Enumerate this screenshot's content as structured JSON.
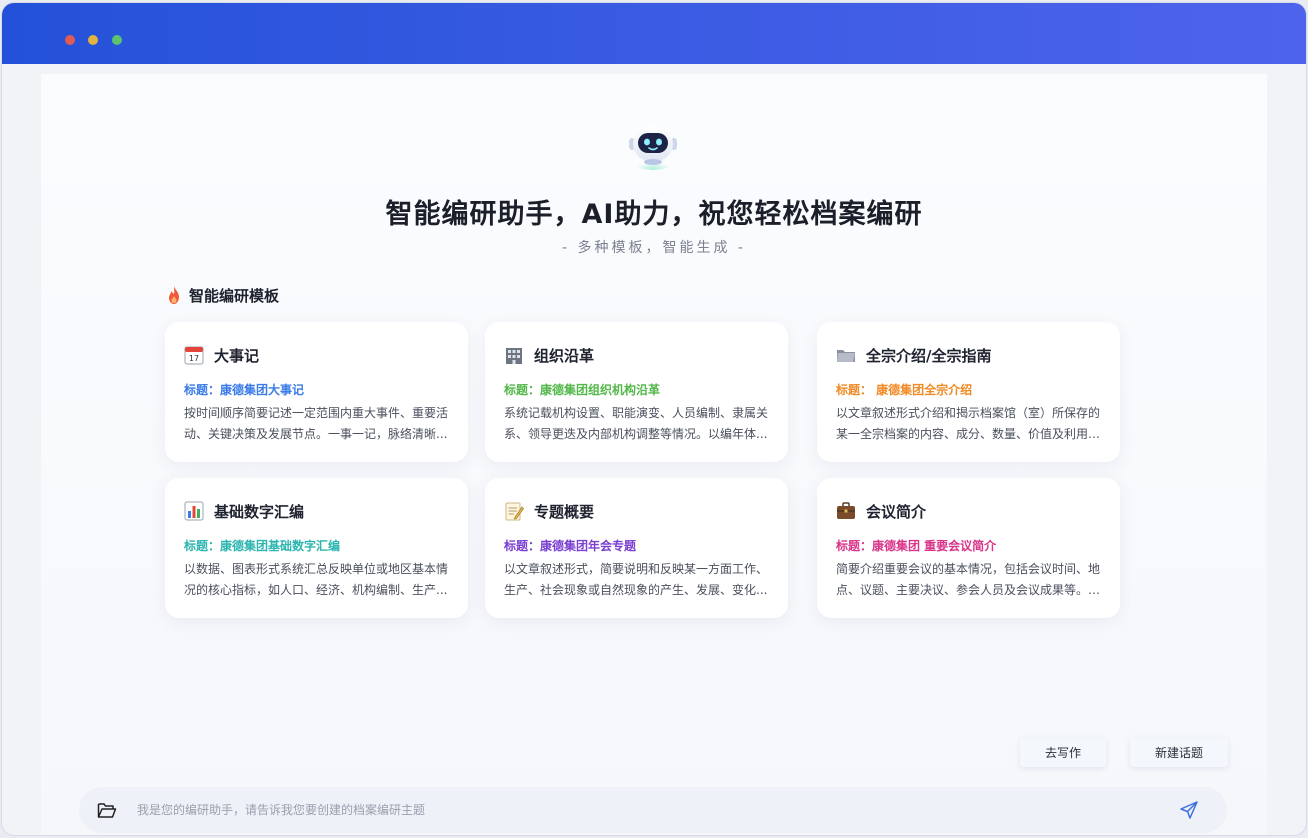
{
  "window": {
    "colors": {
      "titlebar_start": "#2451d9",
      "titlebar_end": "#4e63ec"
    }
  },
  "hero": {
    "title": "智能编研助手，AI助力，祝您轻松档案编研",
    "subtitle": "- 多种模板，智能生成 -",
    "mascot_icon": "robot-icon"
  },
  "section": {
    "title": "智能编研模板",
    "icon": "flame-icon"
  },
  "templates": [
    {
      "icon": "calendar-icon",
      "title": "大事记",
      "subtitle": "标题：康德集团大事记",
      "subtitle_color": "#3b7be8",
      "description": "按时间顺序简要记述一定范围内重大事件、重要活动、关键决策及发展节点。一事一记，脉络清晰..."
    },
    {
      "icon": "building-icon",
      "title": "组织沿革",
      "subtitle": "标题：康德集团组织机构沿革",
      "subtitle_color": "#52b84a",
      "description": "系统记载机构设置、职能演变、人员编制、隶属关系、领导更迭及内部机构调整等情况。以编年体..."
    },
    {
      "icon": "folder-icon",
      "title": "全宗介绍/全宗指南",
      "subtitle": "标题： 康德集团全宗介绍",
      "subtitle_color": "#f08a24",
      "description": "以文章叙述形式介绍和揭示档案馆（室）所保存的某一全宗档案的内容、成分、数量、价值及利用注意事项..."
    },
    {
      "icon": "bar-chart-icon",
      "title": "基础数字汇编",
      "subtitle": "标题：康德集团基础数字汇编",
      "subtitle_color": "#2cb5b0",
      "description": "以数据、图表形式系统汇总反映单位或地区基本情况的核心指标，如人口、经济、机构编制、生产..."
    },
    {
      "icon": "memo-icon",
      "title": "专题概要",
      "subtitle": "标题：康德集团年会专题",
      "subtitle_color": "#7a3fd1",
      "description": "以文章叙述形式，简要说明和反映某一方面工作、生产、社会现象或自然现象的产生、发展、变化..."
    },
    {
      "icon": "briefcase-icon",
      "title": "会议简介",
      "subtitle": "标题：康德集团 重要会议简介",
      "subtitle_color": "#d9348a",
      "description": "简要介绍重要会议的基本情况，包括会议时间、地点、议题、主要决议、参会人员及会议成果等。便于快速..."
    }
  ],
  "actions": {
    "write_label": "去写作",
    "new_topic_label": "新建话题"
  },
  "composer": {
    "value": "",
    "placeholder": "我是您的编研助手，请告诉我您要创建的档案编研主题",
    "attach_icon": "folder-open-icon",
    "send_icon": "send-icon"
  }
}
